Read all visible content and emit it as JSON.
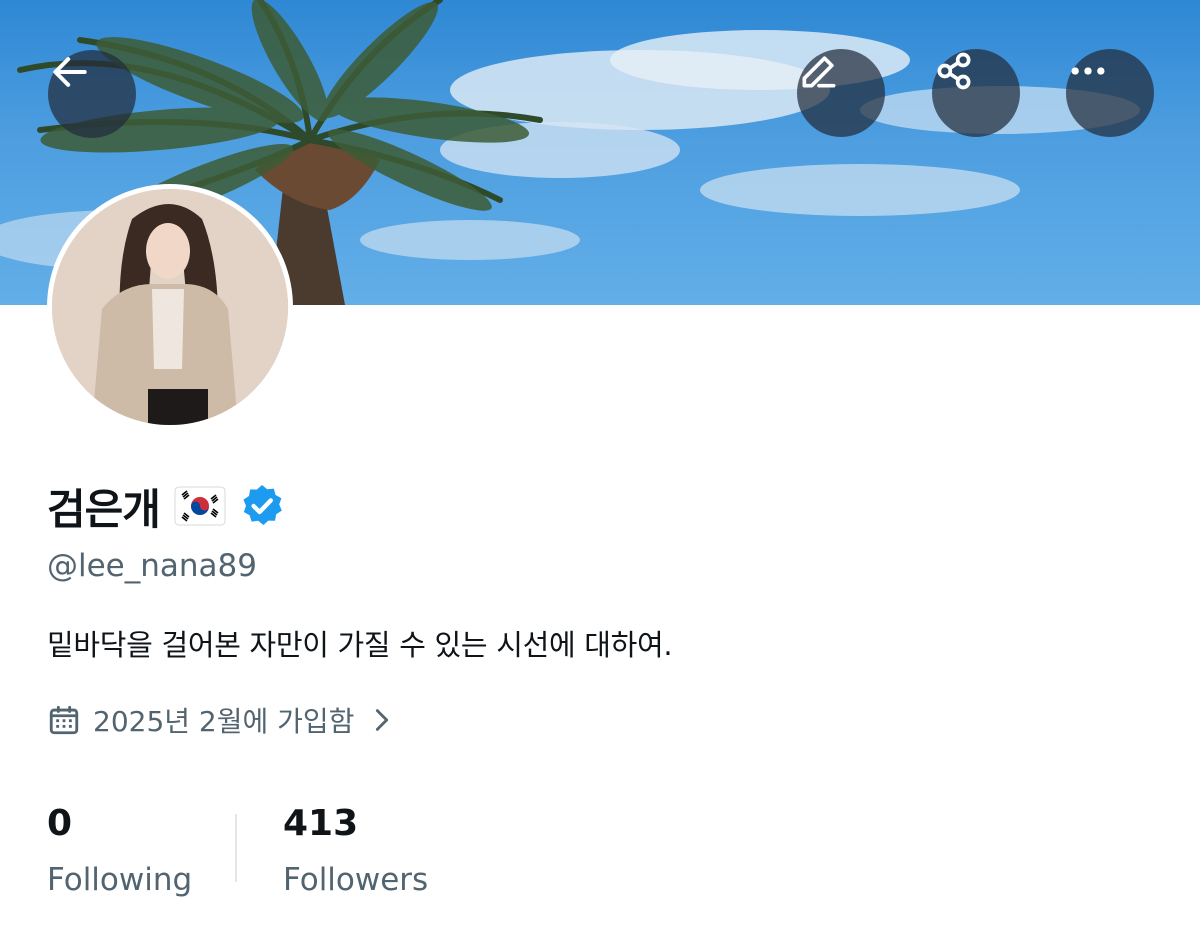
{
  "header": {
    "back_icon": "arrow-left-icon",
    "edit_icon": "pencil-icon",
    "share_icon": "share-icon",
    "more_icon": "more-horizontal-icon"
  },
  "profile": {
    "display_name": "검은개",
    "flag_icon": "south-korea-flag-icon",
    "verified_icon": "verified-badge-icon",
    "verified_color": "#1d9bf0",
    "handle": "@lee_nana89",
    "bio": "밑바닥을 걸어본 자만이 가질 수 있는 시선에 대하여.",
    "joined": "2025년 2월에 가입함",
    "joined_icon": "calendar-icon"
  },
  "stats": {
    "following_count": "0",
    "following_label": "Following",
    "followers_count": "413",
    "followers_label": "Followers"
  },
  "colors": {
    "text_primary": "#0f1419",
    "text_secondary": "#536471",
    "banner_sky": "#4d9ee0"
  }
}
